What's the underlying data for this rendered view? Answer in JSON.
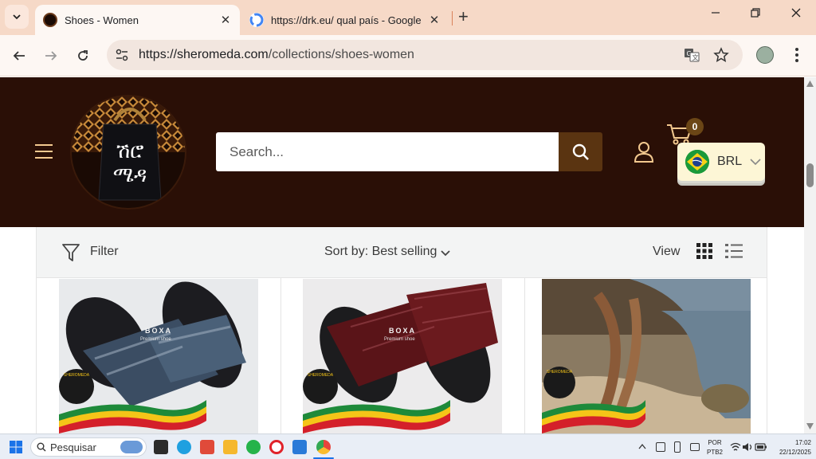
{
  "browser": {
    "tabs": [
      {
        "title": "Shoes - Women",
        "active": true,
        "favicon": "sheromeda-favicon"
      },
      {
        "title": "https://drk.eu/ qual país - Google",
        "active": false,
        "favicon": "google-favicon"
      }
    ],
    "close_glyph": "✕",
    "new_tab_glyph": "+",
    "url_host": "https://sheromeda.com",
    "url_path": "/collections/shoes-women"
  },
  "site": {
    "search_placeholder": "Search...",
    "cart_count": "0",
    "currency_code": "BRL",
    "logo_text_line1": "ሽሮ",
    "logo_text_line2": "ሜዳ",
    "colors": {
      "header_bg": "#2a0f06",
      "search_button": "#5a3411",
      "accent": "#f3c98f"
    }
  },
  "toolbar": {
    "filter_label": "Filter",
    "sort_label": "Sort by: Best selling",
    "view_label": "View"
  },
  "products": [
    {
      "brand_mark": "BOXA",
      "tagline": "Premium shoe",
      "badge": "SHEROMEDA",
      "color": "blue-gray"
    },
    {
      "brand_mark": "BOXA",
      "tagline": "Premium shoe",
      "badge": "SHEROMEDA",
      "color": "burgundy"
    },
    {
      "brand_mark": "",
      "tagline": "",
      "badge": "SHEROMEDA",
      "color": "tan"
    }
  ],
  "taskbar": {
    "search_label": "Pesquisar",
    "lang_line1": "POR",
    "lang_line2": "PTB2",
    "time": "17:02",
    "date": "22/12/2025"
  }
}
